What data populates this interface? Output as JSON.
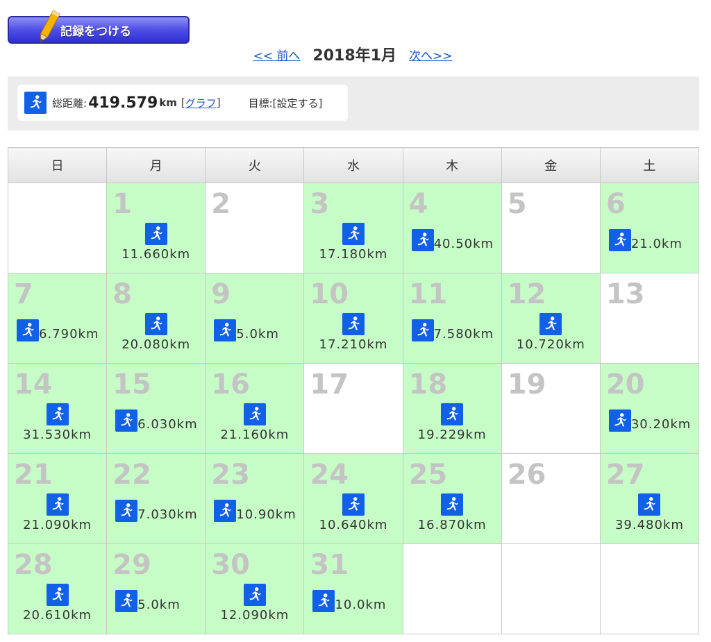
{
  "header": {
    "record_button_label": "記録をつける"
  },
  "nav": {
    "prev_label": "<< 前へ",
    "title": "2018年1月",
    "next_label": "次へ>>"
  },
  "summary": {
    "total_label": "総距離:",
    "total_value": "419.579",
    "total_unit": "km",
    "graph_open": "[",
    "graph_link": "グラフ",
    "graph_close": "]",
    "goal_label": "目標:[設定する]"
  },
  "calendar": {
    "weekdays": [
      "日",
      "月",
      "火",
      "水",
      "木",
      "金",
      "土"
    ],
    "weeks": [
      [
        {
          "day": "",
          "distance": "",
          "layout": ""
        },
        {
          "day": "1",
          "distance": "11.660km",
          "layout": "center"
        },
        {
          "day": "2",
          "distance": "",
          "layout": ""
        },
        {
          "day": "3",
          "distance": "17.180km",
          "layout": "center"
        },
        {
          "day": "4",
          "distance": "40.50km",
          "layout": "inline"
        },
        {
          "day": "5",
          "distance": "",
          "layout": ""
        },
        {
          "day": "6",
          "distance": "21.0km",
          "layout": "inline"
        }
      ],
      [
        {
          "day": "7",
          "distance": "6.790km",
          "layout": "inline"
        },
        {
          "day": "8",
          "distance": "20.080km",
          "layout": "center"
        },
        {
          "day": "9",
          "distance": "5.0km",
          "layout": "inline"
        },
        {
          "day": "10",
          "distance": "17.210km",
          "layout": "center"
        },
        {
          "day": "11",
          "distance": "7.580km",
          "layout": "inline"
        },
        {
          "day": "12",
          "distance": "10.720km",
          "layout": "center"
        },
        {
          "day": "13",
          "distance": "",
          "layout": ""
        }
      ],
      [
        {
          "day": "14",
          "distance": "31.530km",
          "layout": "center"
        },
        {
          "day": "15",
          "distance": "6.030km",
          "layout": "inline"
        },
        {
          "day": "16",
          "distance": "21.160km",
          "layout": "center"
        },
        {
          "day": "17",
          "distance": "",
          "layout": ""
        },
        {
          "day": "18",
          "distance": "19.229km",
          "layout": "center"
        },
        {
          "day": "19",
          "distance": "",
          "layout": ""
        },
        {
          "day": "20",
          "distance": "30.20km",
          "layout": "inline"
        }
      ],
      [
        {
          "day": "21",
          "distance": "21.090km",
          "layout": "center"
        },
        {
          "day": "22",
          "distance": "7.030km",
          "layout": "inline"
        },
        {
          "day": "23",
          "distance": "10.90km",
          "layout": "inline"
        },
        {
          "day": "24",
          "distance": "10.640km",
          "layout": "center"
        },
        {
          "day": "25",
          "distance": "16.870km",
          "layout": "center"
        },
        {
          "day": "26",
          "distance": "",
          "layout": ""
        },
        {
          "day": "27",
          "distance": "39.480km",
          "layout": "center"
        }
      ],
      [
        {
          "day": "28",
          "distance": "20.610km",
          "layout": "center"
        },
        {
          "day": "29",
          "distance": "5.0km",
          "layout": "inline"
        },
        {
          "day": "30",
          "distance": "12.090km",
          "layout": "center"
        },
        {
          "day": "31",
          "distance": "10.0km",
          "layout": "inline"
        },
        {
          "day": "",
          "distance": "",
          "layout": ""
        },
        {
          "day": "",
          "distance": "",
          "layout": ""
        },
        {
          "day": "",
          "distance": "",
          "layout": ""
        }
      ]
    ]
  },
  "icons": {
    "run": "running-person-icon",
    "pencil": "pencil-icon"
  },
  "colors": {
    "run_day_bg": "#c6fdc6",
    "icon_bg": "#1160e8",
    "link": "#1a56c9",
    "day_number": "#c4c4c4"
  }
}
